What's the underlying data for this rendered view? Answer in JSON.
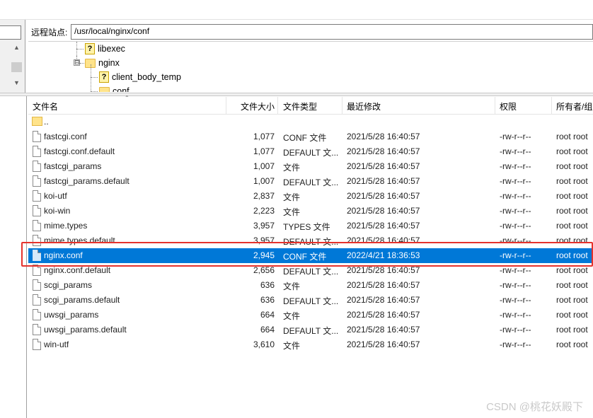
{
  "remote_site": {
    "label": "远程站点:",
    "path": "/usr/local/nginx/conf"
  },
  "tree": [
    {
      "name": "libexec",
      "icon": "question-folder-icon"
    },
    {
      "name": "nginx",
      "icon": "folder-icon",
      "expander": "⊟"
    },
    {
      "name": "client_body_temp",
      "icon": "question-folder-icon"
    },
    {
      "name": "conf",
      "icon": "folder-icon"
    }
  ],
  "columns": {
    "name": "文件名",
    "size": "文件大小",
    "type": "文件类型",
    "modified": "最近修改",
    "perms": "权限",
    "owner": "所有者/组"
  },
  "parent_dir": "..",
  "files": [
    {
      "name": "fastcgi.conf",
      "size": "1,077",
      "type": "CONF 文件",
      "modified": "2021/5/28 16:40:57",
      "perms": "-rw-r--r--",
      "owner": "root root"
    },
    {
      "name": "fastcgi.conf.default",
      "size": "1,077",
      "type": "DEFAULT 文...",
      "modified": "2021/5/28 16:40:57",
      "perms": "-rw-r--r--",
      "owner": "root root"
    },
    {
      "name": "fastcgi_params",
      "size": "1,007",
      "type": "文件",
      "modified": "2021/5/28 16:40:57",
      "perms": "-rw-r--r--",
      "owner": "root root"
    },
    {
      "name": "fastcgi_params.default",
      "size": "1,007",
      "type": "DEFAULT 文...",
      "modified": "2021/5/28 16:40:57",
      "perms": "-rw-r--r--",
      "owner": "root root"
    },
    {
      "name": "koi-utf",
      "size": "2,837",
      "type": "文件",
      "modified": "2021/5/28 16:40:57",
      "perms": "-rw-r--r--",
      "owner": "root root"
    },
    {
      "name": "koi-win",
      "size": "2,223",
      "type": "文件",
      "modified": "2021/5/28 16:40:57",
      "perms": "-rw-r--r--",
      "owner": "root root"
    },
    {
      "name": "mime.types",
      "size": "3,957",
      "type": "TYPES 文件",
      "modified": "2021/5/28 16:40:57",
      "perms": "-rw-r--r--",
      "owner": "root root"
    },
    {
      "name": "mime.types.default",
      "size": "3,957",
      "type": "DEFAULT 文...",
      "modified": "2021/5/28 16:40:57",
      "perms": "-rw-r--r--",
      "owner": "root root"
    },
    {
      "name": "nginx.conf",
      "size": "2,945",
      "type": "CONF 文件",
      "modified": "2022/4/21 18:36:53",
      "perms": "-rw-r--r--",
      "owner": "root root",
      "selected": true
    },
    {
      "name": "nginx.conf.default",
      "size": "2,656",
      "type": "DEFAULT 文...",
      "modified": "2021/5/28 16:40:57",
      "perms": "-rw-r--r--",
      "owner": "root root"
    },
    {
      "name": "scgi_params",
      "size": "636",
      "type": "文件",
      "modified": "2021/5/28 16:40:57",
      "perms": "-rw-r--r--",
      "owner": "root root"
    },
    {
      "name": "scgi_params.default",
      "size": "636",
      "type": "DEFAULT 文...",
      "modified": "2021/5/28 16:40:57",
      "perms": "-rw-r--r--",
      "owner": "root root"
    },
    {
      "name": "uwsgi_params",
      "size": "664",
      "type": "文件",
      "modified": "2021/5/28 16:40:57",
      "perms": "-rw-r--r--",
      "owner": "root root"
    },
    {
      "name": "uwsgi_params.default",
      "size": "664",
      "type": "DEFAULT 文...",
      "modified": "2021/5/28 16:40:57",
      "perms": "-rw-r--r--",
      "owner": "root root"
    },
    {
      "name": "win-utf",
      "size": "3,610",
      "type": "文件",
      "modified": "2021/5/28 16:40:57",
      "perms": "-rw-r--r--",
      "owner": "root root"
    }
  ],
  "colors": {
    "selection": "#0078d7",
    "highlight_box": "#e5322d"
  },
  "watermark": "CSDN @桃花妖殿下"
}
